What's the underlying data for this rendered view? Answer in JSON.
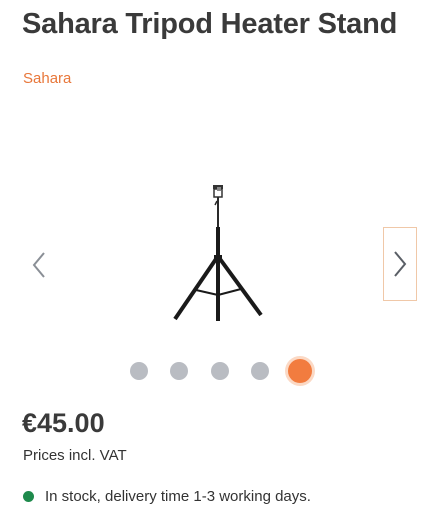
{
  "product": {
    "title": "Sahara Tripod Heater Stand",
    "brand": "Sahara",
    "price": "€45.00",
    "vat_note": "Prices incl. VAT",
    "stock_text": "In stock, delivery time 1-3 working days."
  },
  "gallery": {
    "image_count": 5,
    "active_index": 5,
    "prev_icon": "chevron-left-icon",
    "next_icon": "chevron-right-icon"
  },
  "colors": {
    "brand_orange": "#e8773a",
    "dot_inactive": "#b9bcc2",
    "dot_active": "#f27c3f",
    "stock_green": "#1e8a4c"
  }
}
